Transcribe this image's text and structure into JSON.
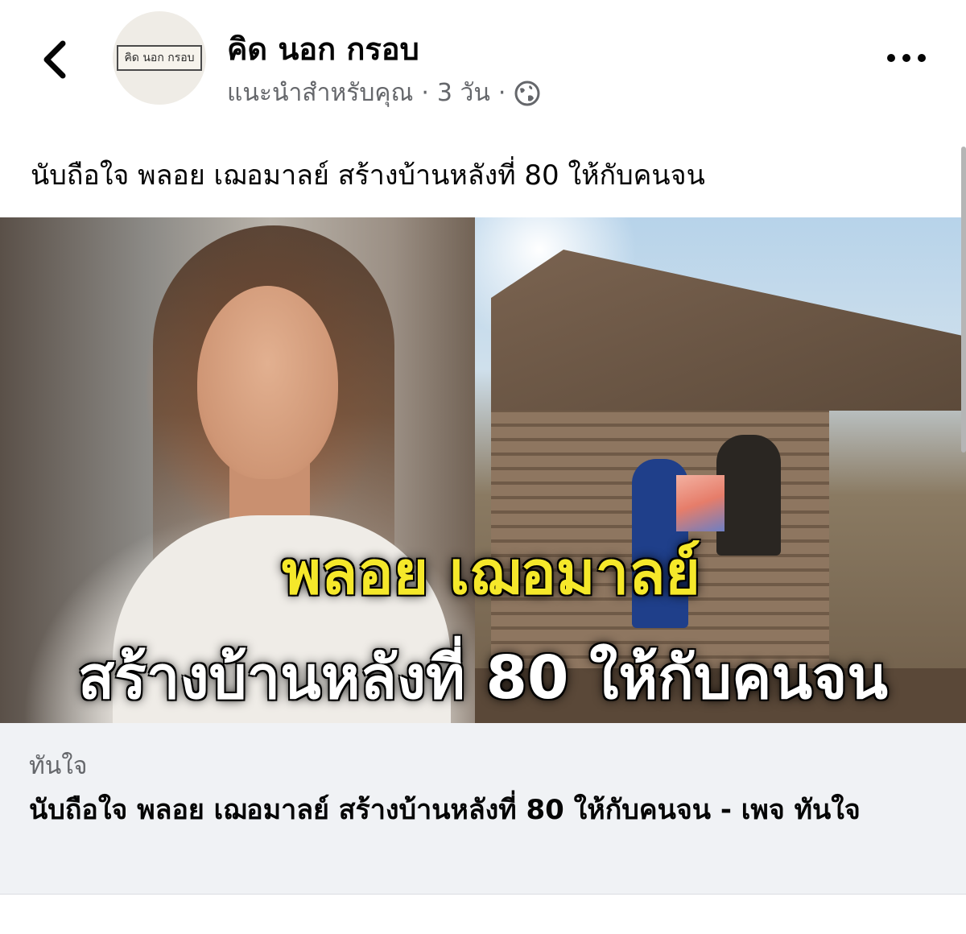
{
  "header": {
    "back_icon": "chevron-left-icon",
    "page_name": "คิด นอก กรอบ",
    "avatar_logo_text": "คิด นอก กรอบ",
    "meta": {
      "reason": "แนะนำสำหรับคุณ",
      "separator": "·",
      "time": "3 วัน",
      "privacy_icon": "globe-icon"
    },
    "more_icon": "more-horizontal-icon"
  },
  "post": {
    "caption": "นับถือใจ พลอย เฌอมาลย์ สร้างบ้านหลังที่ 80 ให้กับคนจน"
  },
  "link_preview": {
    "image_overlay": {
      "title": "พลอย เฌอมาลย์",
      "subtitle": "สร้างบ้านหลังที่  80 ให้กับคนจน"
    },
    "source": "ทันใจ",
    "title": "นับถือใจ พลอย เฌอมาลย์ สร้างบ้านหลังที่ 80 ให้กับคนจน - เพจ ทันใจ"
  },
  "colors": {
    "secondary_text": "#65676b",
    "link_footer_bg": "#f0f2f5",
    "overlay_yellow": "#f5e82a"
  }
}
